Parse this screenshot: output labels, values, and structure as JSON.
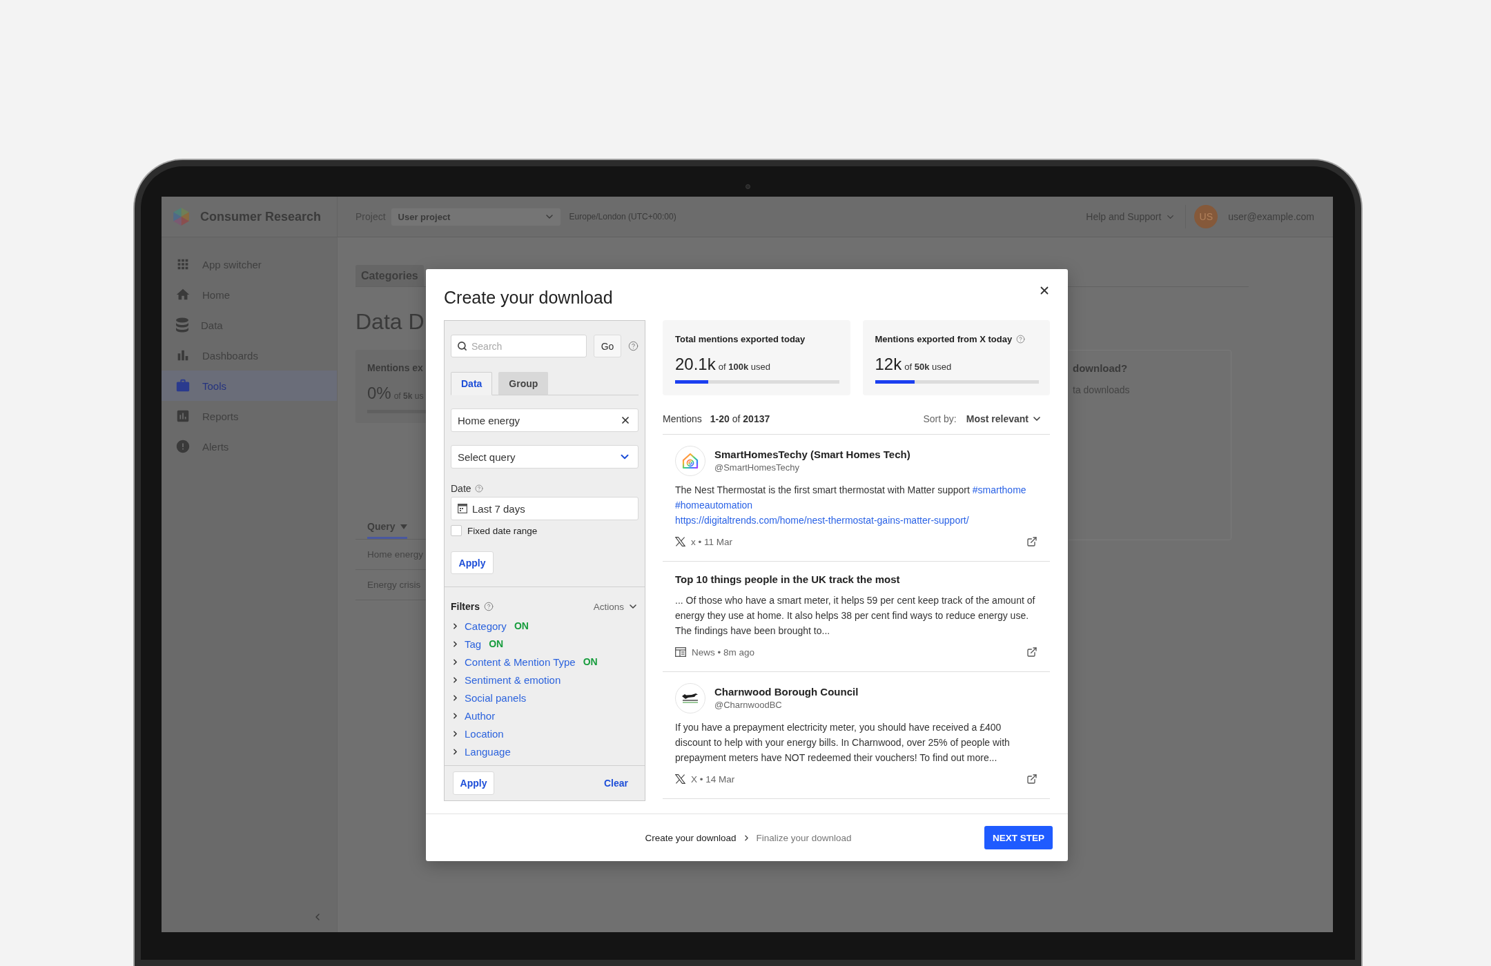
{
  "app": {
    "name": "Consumer Research",
    "project_label": "Project",
    "project": "User project",
    "timezone": "Europe/London (UTC+00:00)",
    "help": "Help and Support",
    "initials": "US",
    "email": "user@example.com"
  },
  "sidebar": {
    "items": [
      {
        "label": "App switcher",
        "selected": false
      },
      {
        "label": "Home",
        "selected": false
      },
      {
        "label": "Data",
        "selected": false
      },
      {
        "label": "Dashboards",
        "selected": false
      },
      {
        "label": "Tools",
        "selected": true
      },
      {
        "label": "Reports",
        "selected": false
      },
      {
        "label": "Alerts",
        "selected": false
      }
    ]
  },
  "page": {
    "tabs": [
      {
        "label": "Categories",
        "selected": false
      }
    ],
    "title": "Data D",
    "usage_card": {
      "title": "Mentions ex",
      "value": "0%",
      "detail": "of **5k** us"
    },
    "info_card": {
      "title": "download?",
      "text": "ta downloads"
    },
    "table": {
      "columns": [
        "Query"
      ],
      "rows": [
        [
          "Home energy"
        ],
        [
          "Energy crisis"
        ]
      ]
    }
  },
  "modal": {
    "title": "Create your download",
    "search": {
      "placeholder": "Search",
      "button": "Go"
    },
    "tabs": [
      {
        "label": "Data",
        "selected": true
      },
      {
        "label": "Group",
        "selected": false
      }
    ],
    "dataset": "Home energy",
    "query_select": {
      "placeholder": "Select query"
    },
    "date": {
      "label": "Date",
      "value": "Last 7 days"
    },
    "fixed_range": {
      "label": "Fixed date range",
      "checked": false
    },
    "apply": "Apply",
    "filters": {
      "title": "Filters",
      "actions": "Actions",
      "items": [
        {
          "label": "Category",
          "status": "ON"
        },
        {
          "label": "Tag",
          "status": "ON"
        },
        {
          "label": "Content & Mention Type",
          "status": "ON"
        },
        {
          "label": "Sentiment & emotion"
        },
        {
          "label": "Social panels"
        },
        {
          "label": "Author"
        },
        {
          "label": "Location"
        },
        {
          "label": "Language"
        }
      ],
      "apply": "Apply",
      "clear": "Clear"
    },
    "stats": [
      {
        "title": "Total mentions exported today",
        "help": false,
        "value": "20.1k",
        "detail": "of **100k** used",
        "level": 0.201
      },
      {
        "title": "Mentions exported from X today",
        "help": true,
        "value": "12k",
        "detail": "of **50k** used",
        "level": 0.24
      }
    ],
    "mentions": {
      "label": "Mentions",
      "range": "**1-20** of **20137**",
      "sort_label": "Sort by:",
      "sort": "Most relevant",
      "items": [
        {
          "kind": "post",
          "author": "SmartHomesTechy (Smart Homes Tech)",
          "handle": "@SmartHomesTechy",
          "text": [
            {
              "kind": "text",
              "text": "The Nest Thermostat is the first smart thermostat with Matter support"
            },
            {
              "kind": "hashtag",
              "text": "#smarthome"
            },
            {
              "kind": "hashtag",
              "text": "#homeautomation"
            },
            {
              "kind": "url",
              "text": "https://digitaltrends.com/home/nest-thermostat-gains-matter-support/"
            }
          ],
          "meta": "x • 11 Mar"
        },
        {
          "kind": "article",
          "title": "Top 10 things people in the UK track the most",
          "text": [
            {
              "kind": "text",
              "text": "... Of those who have a smart meter, it helps 59 per cent keep track of the amount of energy they use at home. It also helps 38 per cent find ways to reduce energy use. The findings have been brought to..."
            }
          ],
          "meta": "News • 8m ago"
        },
        {
          "kind": "post",
          "author": "Charnwood Borough Council",
          "handle": "@CharnwoodBC",
          "text": [
            {
              "kind": "text",
              "text": "If you have a prepayment electricity meter, you should have received a £400 discount to help with your energy bills. In Charnwood, over 25% of people with prepayment meters have NOT redeemed their vouchers! To find out more..."
            }
          ],
          "meta": "X • 14 Mar"
        }
      ]
    },
    "steps": [
      {
        "label": "Create your download",
        "selected": true
      },
      {
        "label": "Finalize your download",
        "selected": false
      }
    ],
    "next": "NEXT STEP"
  }
}
